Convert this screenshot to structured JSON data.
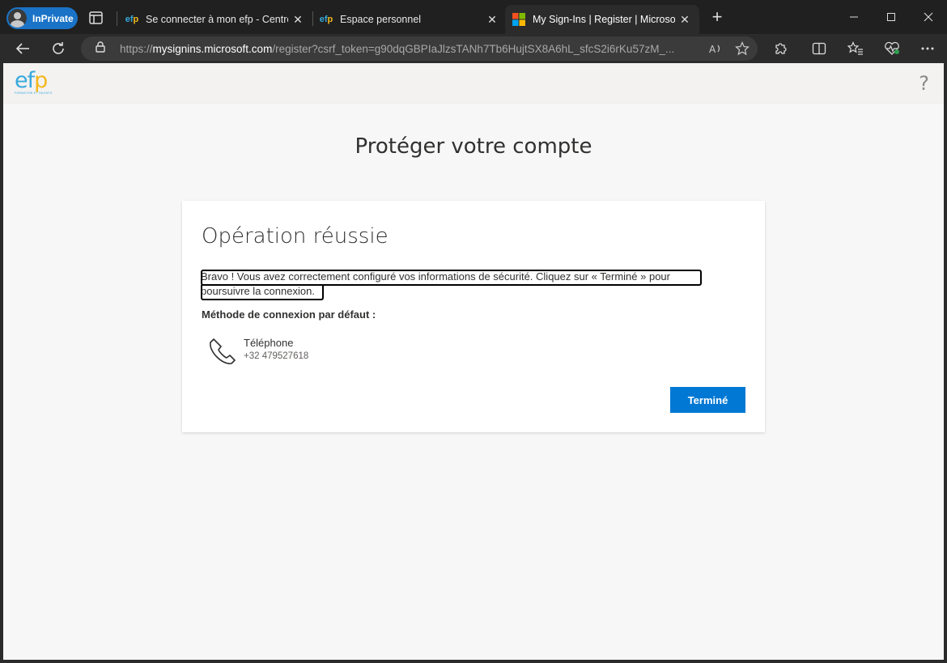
{
  "browser": {
    "inprivate_label": "InPrivate",
    "tabs": [
      {
        "title": "Se connecter à mon efp - Centre d",
        "favicon": "efp"
      },
      {
        "title": "Espace personnel",
        "favicon": "efp"
      },
      {
        "title": "My Sign-Ins | Register | Microsoft",
        "favicon": "microsoft"
      }
    ],
    "new_tab_icon": "+",
    "close_icon": "✕",
    "url_scheme": "https://",
    "url_host": "mysignins.microsoft.com",
    "url_path": "/register?csrf_token=g90dqGBPIaJlzsTANh7Tb6HujtSX8A6hL_sfcS2i6rKu57zM_...",
    "reader_icon": "A ⁾"
  },
  "page": {
    "logo_text": {
      "e": "e",
      "f": "f",
      "p": "p"
    },
    "logo_tagline": "FORMATION ET TALENTS",
    "help_icon": "?",
    "title": "Protéger votre compte",
    "card": {
      "heading": "Opération réussie",
      "message": "Bravo ! Vous avez correctement configuré vos informations de sécurité. Cliquez sur « Terminé » pour poursuivre la connexion.",
      "default_method_label": "Méthode de connexion par défaut :",
      "method_name": "Téléphone",
      "method_value": "+32 479527618",
      "done_button": "Terminé"
    }
  },
  "colors": {
    "accent": "#0078d4",
    "inprivate": "#1a73c7",
    "efp_blue": "#37a9dc",
    "efp_yellow": "#f3b81d"
  }
}
